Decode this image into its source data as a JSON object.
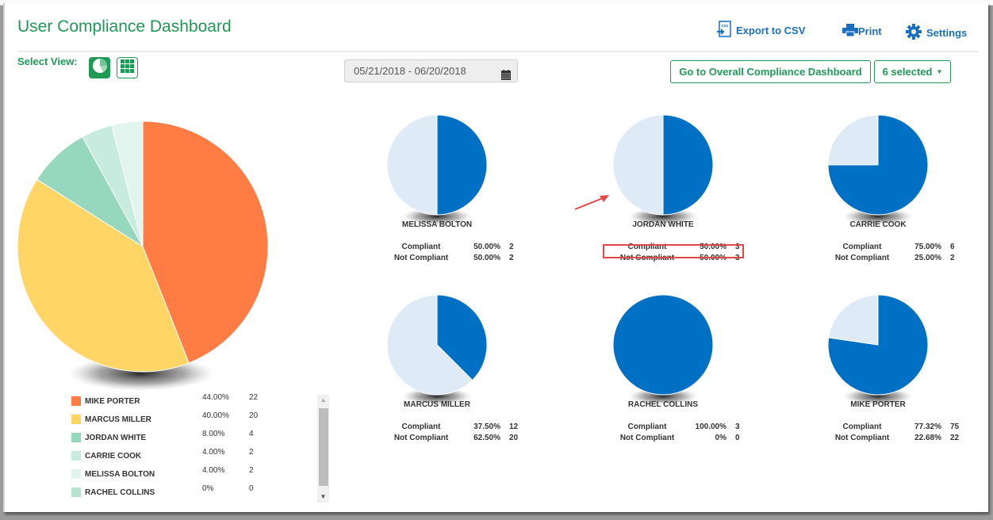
{
  "header": {
    "title": "User Compliance Dashboard",
    "export_label": "Export to CSV",
    "export_icon": "csv-export-icon",
    "print_label": "Print",
    "print_icon": "printer-icon",
    "settings_label": "Settings",
    "settings_icon": "gear-icon"
  },
  "toolbar": {
    "select_view_label": "Select View:",
    "view_options": [
      {
        "name": "pie-view",
        "icon": "pie-chart-icon",
        "active": true
      },
      {
        "name": "grid-view",
        "icon": "grid-icon",
        "active": false
      }
    ],
    "date_range": "05/21/2018 - 06/20/2018",
    "date_icon": "calendar-icon",
    "overall_button": "Go to Overall Compliance Dashboard",
    "users_dropdown": "6 selected"
  },
  "colors": {
    "brand_green": "#1f9a55",
    "link_blue": "#1a6fbf",
    "compliant": "#0070c4",
    "not_compliant": "#deebf7",
    "highlight": "#e04848"
  },
  "legend_scrollbar": {
    "up": "▲",
    "down": "▼"
  },
  "chart_data": [
    {
      "type": "pie",
      "title": "Non-compliance by user",
      "categories": [
        "MIKE PORTER",
        "MARCUS MILLER",
        "JORDAN WHITE",
        "CARRIE COOK",
        "MELISSA BOLTON",
        "RACHEL COLLINS"
      ],
      "values": [
        22,
        20,
        4,
        2,
        2,
        0
      ],
      "percent_labels": [
        "44.00%",
        "40.00%",
        "8.00%",
        "4.00%",
        "4.00%",
        "0%"
      ],
      "count_labels": [
        "22",
        "20",
        "4",
        "2",
        "2",
        "0"
      ],
      "colors": [
        "#ff7c45",
        "#ffd565",
        "#95d8bd",
        "#c8ebdf",
        "#e2f4ee",
        "#b4e4d0"
      ],
      "legend": "bottom"
    },
    {
      "type": "pie",
      "title": "MELISSA BOLTON",
      "categories": [
        "Compliant",
        "Not Compliant"
      ],
      "values": [
        2,
        2
      ],
      "percent_labels": [
        "50.00%",
        "50.00%"
      ],
      "count_labels": [
        "2",
        "2"
      ]
    },
    {
      "type": "pie",
      "title": "JORDAN WHITE",
      "categories": [
        "Compliant",
        "Not Compliant"
      ],
      "values": [
        3,
        3
      ],
      "percent_labels": [
        "50.00%",
        "50.00%"
      ],
      "count_labels": [
        "3",
        "3"
      ],
      "highlighted_row": "Compliant"
    },
    {
      "type": "pie",
      "title": "CARRIE COOK",
      "categories": [
        "Compliant",
        "Not Compliant"
      ],
      "values": [
        6,
        2
      ],
      "percent_labels": [
        "75.00%",
        "25.00%"
      ],
      "count_labels": [
        "6",
        "2"
      ]
    },
    {
      "type": "pie",
      "title": "MARCUS MILLER",
      "categories": [
        "Compliant",
        "Not Compliant"
      ],
      "values": [
        12,
        20
      ],
      "percent_labels": [
        "37.50%",
        "62.50%"
      ],
      "count_labels": [
        "12",
        "20"
      ]
    },
    {
      "type": "pie",
      "title": "RACHEL COLLINS",
      "categories": [
        "Compliant",
        "Not Compliant"
      ],
      "values": [
        3,
        0
      ],
      "percent_labels": [
        "100.00%",
        "0%"
      ],
      "count_labels": [
        "3",
        "0"
      ]
    },
    {
      "type": "pie",
      "title": "MIKE PORTER",
      "categories": [
        "Compliant",
        "Not Compliant"
      ],
      "values": [
        75,
        22
      ],
      "percent_labels": [
        "77.32%",
        "22.68%"
      ],
      "count_labels": [
        "75",
        "22"
      ]
    }
  ]
}
